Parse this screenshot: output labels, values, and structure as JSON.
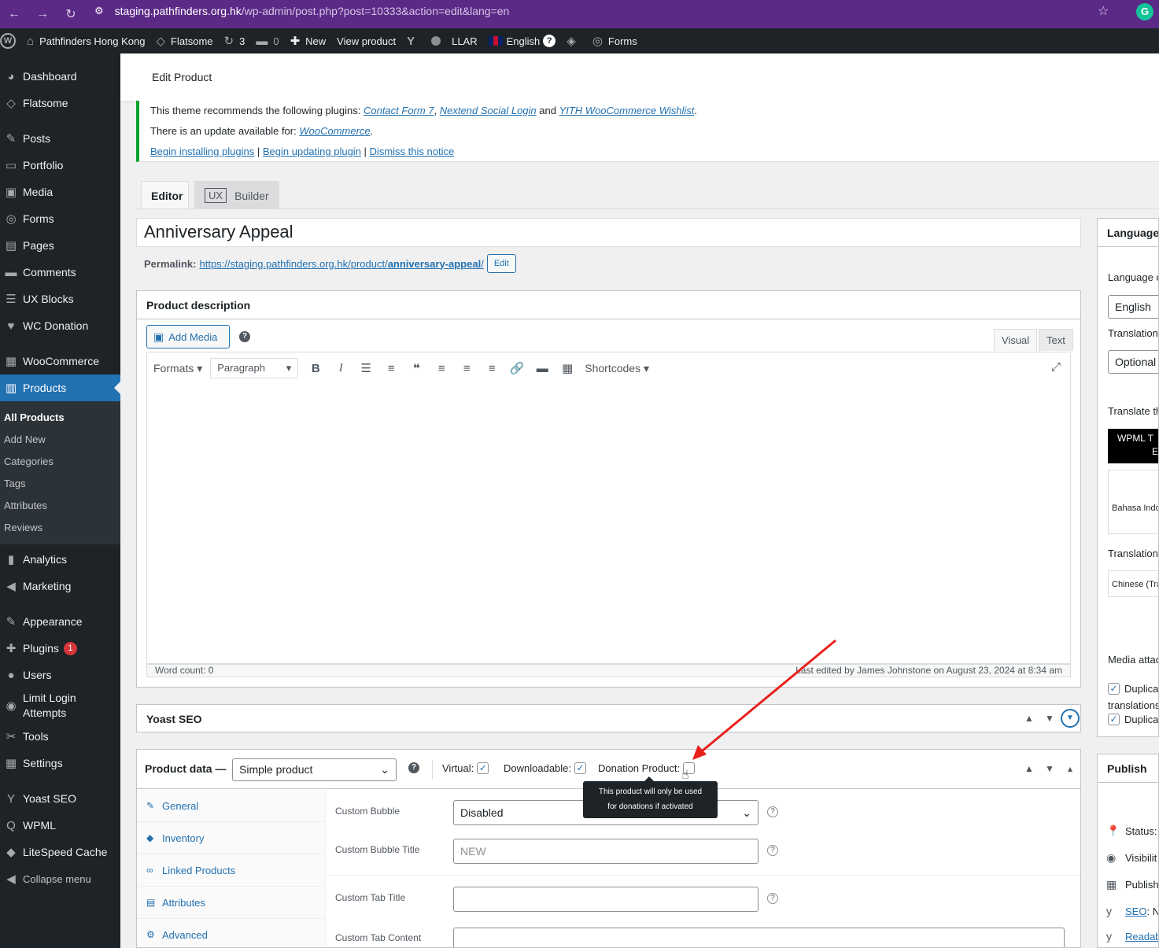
{
  "browser": {
    "url_domain": "staging.pathfinders.org.hk",
    "url_path": "/wp-admin/post.php?post=10333&action=edit&lang=en",
    "nav_back": "←",
    "nav_forward": "→",
    "nav_reload": "↻",
    "site_icon": "⚙",
    "star": "☆",
    "extension": "G"
  },
  "adminbar": {
    "site_name": "Pathfinders Hong Kong",
    "theme": "Flatsome",
    "updates_count": "3",
    "comments_count": "0",
    "new_label": "New",
    "view_product": "View product",
    "llar": "LLAR",
    "language": "English",
    "help": "?",
    "forms": "Forms"
  },
  "sidebar": {
    "items": [
      {
        "label": "Dashboard",
        "icon": "◕"
      },
      {
        "label": "Flatsome",
        "icon": "◇"
      },
      {
        "label": "Posts",
        "icon": "✎"
      },
      {
        "label": "Portfolio",
        "icon": "▭"
      },
      {
        "label": "Media",
        "icon": "▣"
      },
      {
        "label": "Forms",
        "icon": "◎"
      },
      {
        "label": "Pages",
        "icon": "▤"
      },
      {
        "label": "Comments",
        "icon": "▬"
      },
      {
        "label": "UX Blocks",
        "icon": "☰"
      },
      {
        "label": "WC Donation",
        "icon": "♥"
      },
      {
        "label": "WooCommerce",
        "icon": "▦"
      },
      {
        "label": "Products",
        "icon": "▥"
      }
    ],
    "submenu": [
      "All Products",
      "Add New",
      "Categories",
      "Tags",
      "Attributes",
      "Reviews"
    ],
    "items2": [
      {
        "label": "Analytics",
        "icon": "▮"
      },
      {
        "label": "Marketing",
        "icon": "◀"
      },
      {
        "label": "Appearance",
        "icon": "✎"
      },
      {
        "label": "Plugins",
        "icon": "✚"
      },
      {
        "label": "Users",
        "icon": "●"
      },
      {
        "label": "Limit Login Attempts",
        "icon": "◉"
      },
      {
        "label": "Tools",
        "icon": "✂"
      },
      {
        "label": "Settings",
        "icon": "▦"
      },
      {
        "label": "Yoast SEO",
        "icon": "Y"
      },
      {
        "label": "WPML",
        "icon": "Q"
      },
      {
        "label": "LiteSpeed Cache",
        "icon": "◆"
      },
      {
        "label": "Collapse menu",
        "icon": "◀"
      }
    ],
    "plugins_badge": "1"
  },
  "header": {
    "title": "Edit Product"
  },
  "notice": {
    "line1_prefix": "This theme recommends the following plugins: ",
    "plugin1": "Contact Form 7",
    "sep1": ", ",
    "plugin2": "Nextend Social Login",
    "and": " and ",
    "plugin3": "YITH WooCommerce Wishlist",
    "period": ".",
    "line2_prefix": "There is an update available for: ",
    "plugin4": "WooCommerce",
    "link1": "Begin installing plugins",
    "link2": "Begin updating plugin",
    "link3": "Dismiss this notice",
    "pipe": " | "
  },
  "editor_tabs": {
    "editor": "Editor",
    "ux": "UX",
    "builder": "Builder"
  },
  "post": {
    "title": "Anniversary Appeal",
    "permalink_label": "Permalink:",
    "permalink_url": "https://staging.pathfinders.org.hk/product/",
    "permalink_slug": "anniversary-appeal",
    "permalink_end": "/",
    "edit_btn": "Edit"
  },
  "description": {
    "title": "Product description",
    "add_media": "Add Media",
    "help": "?",
    "tab_visual": "Visual",
    "tab_text": "Text",
    "formats": "Formats ▾",
    "paragraph": "Paragraph",
    "shortcodes": "Shortcodes ▾",
    "word_count": "Word count: 0",
    "last_edited": "Last edited by James Johnstone on August 23, 2024 at 8:34 am"
  },
  "yoast": {
    "title": "Yoast SEO"
  },
  "product_data": {
    "title": "Product data —",
    "type": "Simple product",
    "virtual_label": "Virtual:",
    "virtual_checked": true,
    "downloadable_label": "Downloadable:",
    "downloadable_checked": true,
    "donation_label": "Donation Product:",
    "donation_checked": false,
    "tooltip_line1": "This product will only be used",
    "tooltip_line2": "for donations if activated",
    "tabs": [
      {
        "label": "General",
        "icon": "🔧"
      },
      {
        "label": "Inventory",
        "icon": "◆"
      },
      {
        "label": "Linked Products",
        "icon": "🔗"
      },
      {
        "label": "Attributes",
        "icon": "▤"
      },
      {
        "label": "Advanced",
        "icon": "⚙"
      }
    ],
    "fields": {
      "bubble_label": "Custom Bubble",
      "bubble_value": "Disabled",
      "bubble_title_label": "Custom Bubble Title",
      "bubble_title_placeholder": "NEW",
      "tab_title_label": "Custom Tab Title",
      "tab_content_label": "Custom Tab Content"
    }
  },
  "right": {
    "language_title": "Language",
    "language_of": "Language o",
    "language_value": "English",
    "translation_label": "Translation",
    "translation_value": "Optional",
    "translate_this": "Translate th",
    "wpml_btn_l1": "WPML T",
    "wpml_btn_l2": "Ec",
    "bahasa": "Bahasa Indon",
    "translations": "Translations",
    "chinese": "Chinese (Trad",
    "media_attach": "Media attac",
    "dup1": "Duplica",
    "translations_word": "translations",
    "dup2": "Duplica",
    "publish_title": "Publish",
    "status": "Status:",
    "visibility": "Visibilit",
    "publish": "Publish",
    "seo_link": "SEO",
    "seo_rest": ": No",
    "readab": "Readab"
  },
  "colors": {
    "wp_blue": "#2271b1",
    "admin_dark": "#1d2327",
    "browser_purple": "#5b2a86",
    "notice_green": "#00a32a",
    "annotation_red": "#e8201c"
  }
}
